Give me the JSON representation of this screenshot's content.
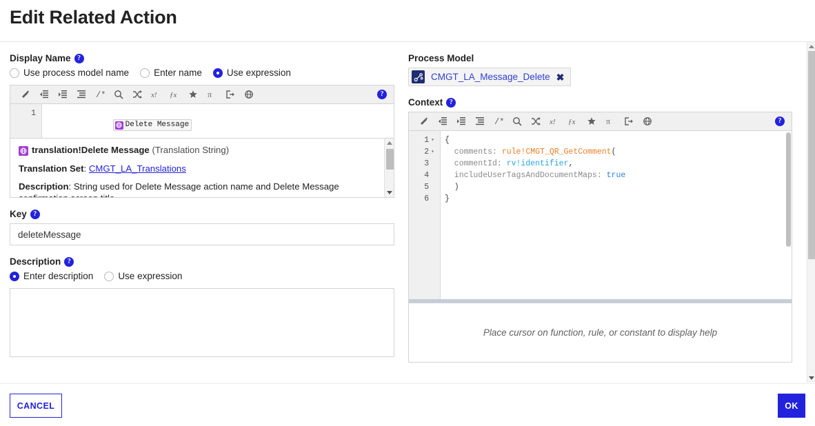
{
  "dialog": {
    "title": "Edit Related Action"
  },
  "display_name": {
    "label": "Display Name",
    "help_glyph": "?",
    "options": [
      {
        "label": "Use process model name",
        "selected": false
      },
      {
        "label": "Enter name",
        "selected": false
      },
      {
        "label": "Use expression",
        "selected": true
      }
    ],
    "editor": {
      "toolbar_icons": [
        "format-wand-icon",
        "outdent-icon",
        "indent-icon",
        "align-list-icon",
        "comment-icon",
        "search-icon",
        "shuffle-icon",
        "variable-icon",
        "function-icon",
        "star-icon",
        "pi-icon",
        "export-icon",
        "translation-icon"
      ],
      "help_glyph": "?",
      "lines": [
        {
          "number": "1",
          "token_icon": "translation-icon",
          "token_text": "Delete Message"
        }
      ]
    },
    "info": {
      "icon": "translation-icon",
      "name": "translation!Delete Message",
      "type": "(Translation String)",
      "translation_set_label": "Translation Set",
      "translation_set_value": "CMGT_LA_Translations",
      "description_label": "Description",
      "description_value": "String used for Delete Message action name and Delete Message confirmation screen title"
    }
  },
  "key": {
    "label": "Key",
    "help_glyph": "?",
    "value": "deleteMessage",
    "placeholder": ""
  },
  "description": {
    "label": "Description",
    "help_glyph": "?",
    "options": [
      {
        "label": "Enter description",
        "selected": true
      },
      {
        "label": "Use expression",
        "selected": false
      }
    ],
    "value": "",
    "placeholder": ""
  },
  "process_model": {
    "label": "Process Model",
    "icon": "process-model-icon",
    "name": "CMGT_LA_Message_Delete",
    "remove_glyph": "✖"
  },
  "context": {
    "label": "Context",
    "help_glyph": "?",
    "editor": {
      "toolbar_icons": [
        "format-wand-icon",
        "outdent-icon",
        "indent-icon",
        "align-list-icon",
        "comment-icon",
        "search-icon",
        "shuffle-icon",
        "variable-icon",
        "function-icon",
        "star-icon",
        "pi-icon",
        "export-icon",
        "translation-icon"
      ],
      "help_glyph": "?",
      "lines": [
        {
          "number": "1",
          "fold": true,
          "segments": [
            {
              "t": "{",
              "c": "punct"
            }
          ]
        },
        {
          "number": "2",
          "fold": true,
          "segments": [
            {
              "t": "  comments: ",
              "c": "plain"
            },
            {
              "t": "rule!CMGT_QR_GetComment",
              "c": "rule"
            },
            {
              "t": "(",
              "c": "punct"
            }
          ]
        },
        {
          "number": "3",
          "fold": false,
          "segments": [
            {
              "t": "  commentId: ",
              "c": "plain"
            },
            {
              "t": "rv!identifier",
              "c": "var"
            },
            {
              "t": ",",
              "c": "punct"
            }
          ]
        },
        {
          "number": "4",
          "fold": false,
          "segments": [
            {
              "t": "  includeUserTagsAndDocumentMaps: ",
              "c": "plain"
            },
            {
              "t": "true",
              "c": "kw"
            }
          ]
        },
        {
          "number": "5",
          "fold": false,
          "segments": [
            {
              "t": "  )",
              "c": "punct"
            }
          ]
        },
        {
          "number": "6",
          "fold": false,
          "segments": [
            {
              "t": "}",
              "c": "punct"
            }
          ]
        }
      ]
    },
    "help_pane_text": "Place cursor on function, rule, or constant to display help"
  },
  "footer": {
    "cancel_label": "CANCEL",
    "ok_label": "OK"
  },
  "colors": {
    "accent": "#2322dc",
    "rule_token": "#ef7d24",
    "var_token": "#2aa3e0",
    "keyword_token": "#2a7fe0",
    "translation_icon": "#a33dd6",
    "process_model_icon": "#1f2d72"
  }
}
